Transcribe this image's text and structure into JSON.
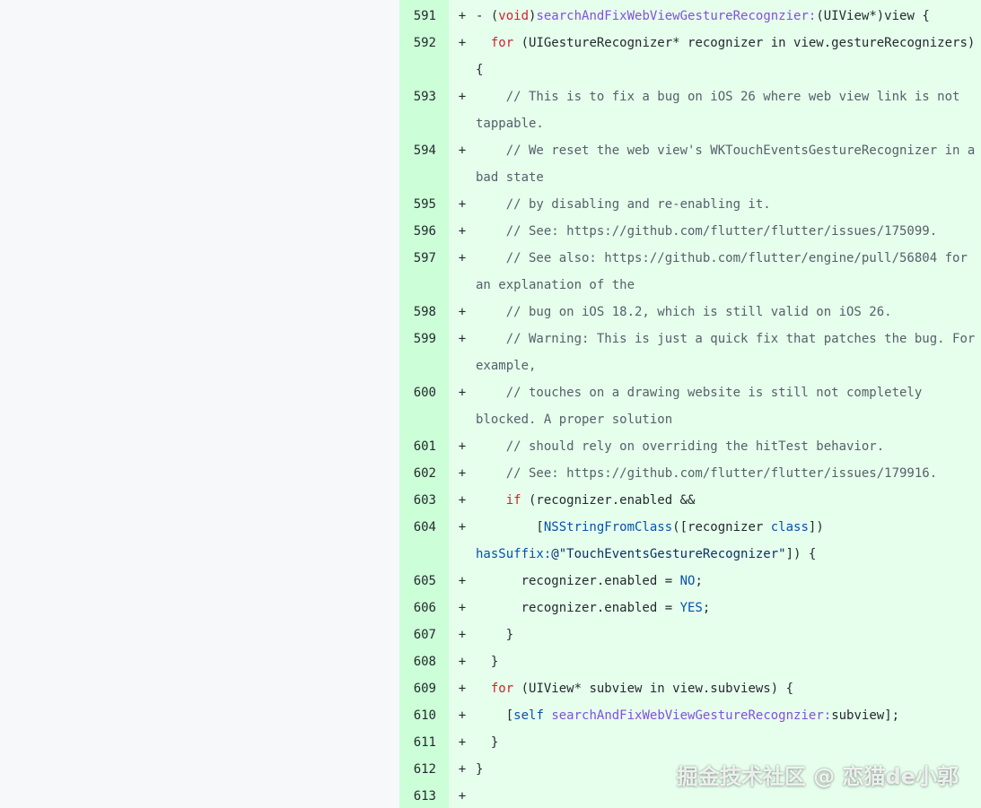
{
  "diff": {
    "lines": [
      {
        "num": "591",
        "marker": "+",
        "parts": [
          {
            "t": "- (",
            "c": "plain"
          },
          {
            "t": "void",
            "c": "kw"
          },
          {
            "t": ")",
            "c": "plain"
          },
          {
            "t": "searchAndFixWebViewGestureRecognzier:",
            "c": "fn"
          },
          {
            "t": "(UIView*)view {",
            "c": "plain"
          }
        ]
      },
      {
        "num": "592",
        "marker": "+",
        "parts": [
          {
            "t": "  ",
            "c": "plain"
          },
          {
            "t": "for",
            "c": "kw"
          },
          {
            "t": " (UIGestureRecognizer* recognizer in view.gestureRecognizers)",
            "c": "plain"
          }
        ]
      },
      {
        "num": "",
        "marker": "",
        "parts": [
          {
            "t": "{",
            "c": "plain"
          }
        ]
      },
      {
        "num": "593",
        "marker": "+",
        "parts": [
          {
            "t": "    // This is to fix a bug on iOS 26 where web view link is not",
            "c": "comment"
          }
        ]
      },
      {
        "num": "",
        "marker": "",
        "parts": [
          {
            "t": "tappable.",
            "c": "comment"
          }
        ]
      },
      {
        "num": "594",
        "marker": "+",
        "parts": [
          {
            "t": "    // We reset the web view's WKTouchEventsGestureRecognizer in a",
            "c": "comment"
          }
        ]
      },
      {
        "num": "",
        "marker": "",
        "parts": [
          {
            "t": "bad state",
            "c": "comment"
          }
        ]
      },
      {
        "num": "595",
        "marker": "+",
        "parts": [
          {
            "t": "    // by disabling and re-enabling it.",
            "c": "comment"
          }
        ]
      },
      {
        "num": "596",
        "marker": "+",
        "parts": [
          {
            "t": "    // See: https://github.com/flutter/flutter/issues/175099.",
            "c": "comment"
          }
        ]
      },
      {
        "num": "597",
        "marker": "+",
        "parts": [
          {
            "t": "    // See also: https://github.com/flutter/engine/pull/56804 for",
            "c": "comment"
          }
        ]
      },
      {
        "num": "",
        "marker": "",
        "parts": [
          {
            "t": "an explanation of the",
            "c": "comment"
          }
        ]
      },
      {
        "num": "598",
        "marker": "+",
        "parts": [
          {
            "t": "    // bug on iOS 18.2, which is still valid on iOS 26.",
            "c": "comment"
          }
        ]
      },
      {
        "num": "599",
        "marker": "+",
        "parts": [
          {
            "t": "    // Warning: This is just a quick fix that patches the bug. For",
            "c": "comment"
          }
        ]
      },
      {
        "num": "",
        "marker": "",
        "parts": [
          {
            "t": "example,",
            "c": "comment"
          }
        ]
      },
      {
        "num": "600",
        "marker": "+",
        "parts": [
          {
            "t": "    // touches on a drawing website is still not completely",
            "c": "comment"
          }
        ]
      },
      {
        "num": "",
        "marker": "",
        "parts": [
          {
            "t": "blocked. A proper solution",
            "c": "comment"
          }
        ]
      },
      {
        "num": "601",
        "marker": "+",
        "parts": [
          {
            "t": "    // should rely on overriding the hitTest behavior.",
            "c": "comment"
          }
        ]
      },
      {
        "num": "602",
        "marker": "+",
        "parts": [
          {
            "t": "    // See: https://github.com/flutter/flutter/issues/179916.",
            "c": "comment"
          }
        ]
      },
      {
        "num": "603",
        "marker": "+",
        "parts": [
          {
            "t": "    ",
            "c": "plain"
          },
          {
            "t": "if",
            "c": "kw"
          },
          {
            "t": " (recognizer.enabled &&",
            "c": "plain"
          }
        ]
      },
      {
        "num": "604",
        "marker": "+",
        "parts": [
          {
            "t": "        [",
            "c": "plain"
          },
          {
            "t": "NSStringFromClass",
            "c": "ent"
          },
          {
            "t": "([recognizer ",
            "c": "plain"
          },
          {
            "t": "class",
            "c": "ent"
          },
          {
            "t": "])",
            "c": "plain"
          }
        ]
      },
      {
        "num": "",
        "marker": "",
        "parts": [
          {
            "t": "hasSuffix:",
            "c": "ent"
          },
          {
            "t": "@\"TouchEventsGestureRecognizer\"",
            "c": "str"
          },
          {
            "t": "]) {",
            "c": "plain"
          }
        ]
      },
      {
        "num": "605",
        "marker": "+",
        "parts": [
          {
            "t": "      recognizer.enabled = ",
            "c": "plain"
          },
          {
            "t": "NO",
            "c": "ent"
          },
          {
            "t": ";",
            "c": "plain"
          }
        ]
      },
      {
        "num": "606",
        "marker": "+",
        "parts": [
          {
            "t": "      recognizer.enabled = ",
            "c": "plain"
          },
          {
            "t": "YES",
            "c": "ent"
          },
          {
            "t": ";",
            "c": "plain"
          }
        ]
      },
      {
        "num": "607",
        "marker": "+",
        "parts": [
          {
            "t": "    }",
            "c": "plain"
          }
        ]
      },
      {
        "num": "608",
        "marker": "+",
        "parts": [
          {
            "t": "  }",
            "c": "plain"
          }
        ]
      },
      {
        "num": "609",
        "marker": "+",
        "parts": [
          {
            "t": "  ",
            "c": "plain"
          },
          {
            "t": "for",
            "c": "kw"
          },
          {
            "t": " (UIView* subview in view.subviews) {",
            "c": "plain"
          }
        ]
      },
      {
        "num": "610",
        "marker": "+",
        "parts": [
          {
            "t": "    [",
            "c": "plain"
          },
          {
            "t": "self",
            "c": "ent"
          },
          {
            "t": " ",
            "c": "plain"
          },
          {
            "t": "searchAndFixWebViewGestureRecognzier:",
            "c": "fn"
          },
          {
            "t": "subview];",
            "c": "plain"
          }
        ]
      },
      {
        "num": "611",
        "marker": "+",
        "parts": [
          {
            "t": "  }",
            "c": "plain"
          }
        ]
      },
      {
        "num": "612",
        "marker": "+",
        "parts": [
          {
            "t": "}",
            "c": "plain"
          }
        ]
      },
      {
        "num": "613",
        "marker": "+",
        "parts": []
      }
    ]
  },
  "watermark": "掘金技术社区 @ 恋猫de小郭",
  "colors": {
    "added_line_bg": "#e6ffec",
    "added_gutter_bg": "#ccffd8",
    "keyword": "#cf222e",
    "function": "#8250df",
    "entity": "#0550ae",
    "comment": "#57606a"
  }
}
